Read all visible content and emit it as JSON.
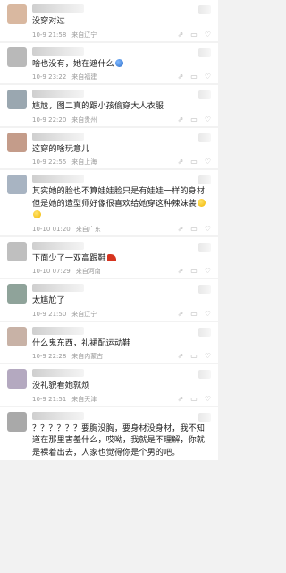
{
  "comments": [
    {
      "avatar_color": "#d9b8a0",
      "text": "没穿对过",
      "time": "10-9 21:58",
      "location": "来自辽宁",
      "emoji": ""
    },
    {
      "avatar_color": "#b9b9b9",
      "text": "啥也没有，她在遮什么",
      "time": "10-9 23:22",
      "location": "来自福建",
      "emoji": "ball"
    },
    {
      "avatar_color": "#9aa7b0",
      "text": "尴尬，图二真的跟小孩偷穿大人衣服",
      "time": "10-9 22:20",
      "location": "来自贵州",
      "emoji": ""
    },
    {
      "avatar_color": "#c49c8a",
      "text": "这穿的啥玩意儿",
      "time": "10-9 22:55",
      "location": "来自上海",
      "emoji": ""
    },
    {
      "avatar_color": "#a8b4c2",
      "text": "其实她的脸也不算娃娃脸只是有娃娃一样的身材 但是她的造型师好像很喜欢给她穿这种辣妹装",
      "time": "10-10 01:20",
      "location": "来自广东",
      "emoji": "laugh2"
    },
    {
      "avatar_color": "#bfbfbf",
      "text": "下面少了一双高跟鞋",
      "time": "10-10 07:29",
      "location": "来自河南",
      "emoji": "heel"
    },
    {
      "avatar_color": "#8fa39a",
      "text": "太尴尬了",
      "time": "10-9 21:50",
      "location": "来自辽宁",
      "emoji": ""
    },
    {
      "avatar_color": "#c8b2a6",
      "text": "什么鬼东西，礼裙配运动鞋",
      "time": "10-9 22:28",
      "location": "来自内蒙古",
      "emoji": ""
    },
    {
      "avatar_color": "#b4a9c0",
      "text": "没礼貌看她就烦",
      "time": "10-9 21:51",
      "location": "来自天津",
      "emoji": ""
    },
    {
      "avatar_color": "#a9a9a9",
      "text": "？？？？？？要胸没胸，要身材没身材，我不知道在那里害羞什么，哎呦，我就是不理解，你就是裸着出去，人家也觉得你是个男的吧。",
      "time": "",
      "location": "",
      "emoji": ""
    }
  ]
}
